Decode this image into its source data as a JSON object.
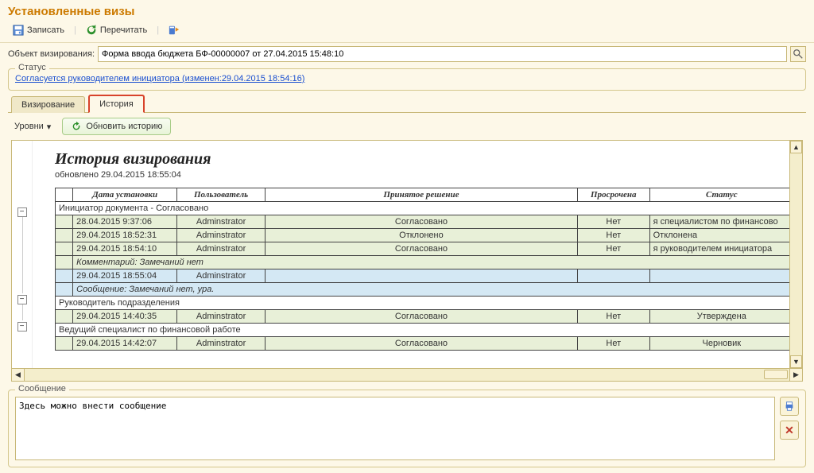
{
  "title": "Установленные визы",
  "toolbar": {
    "write": "Записать",
    "reread": "Перечитать"
  },
  "form": {
    "object_label": "Объект визирования:",
    "object_value": "Форма ввода бюджета БФ-00000007 от 27.04.2015 15:48:10"
  },
  "status_box": {
    "legend": "Статус",
    "text": "Согласуется руководителем инициатора (изменен:29.04.2015 18:54:16)"
  },
  "tabs": {
    "visirovanie": "Визирование",
    "istoriya": "История"
  },
  "subbar": {
    "levels": "Уровни",
    "refresh": "Обновить историю"
  },
  "history": {
    "title": "История визирования",
    "updated": "обновлено 29.04.2015 18:55:04",
    "headers": {
      "date": "Дата установки",
      "user": "Пользователь",
      "decision": "Принятое решение",
      "overdue": "Просрочена",
      "status": "Статус"
    },
    "section1": "Инициатор документа - Согласовано",
    "rows1": [
      {
        "date": "28.04.2015 9:37:06",
        "user": "Adminstrator",
        "decision": "Согласовано",
        "overdue": "Нет",
        "status": "я специалистом по финансово"
      },
      {
        "date": "29.04.2015 18:52:31",
        "user": "Adminstrator",
        "decision": "Отклонено",
        "overdue": "Нет",
        "status": "Отклонена"
      },
      {
        "date": "29.04.2015 18:54:10",
        "user": "Adminstrator",
        "decision": "Согласовано",
        "overdue": "Нет",
        "status": "я руководителем инициатора"
      }
    ],
    "comment1": "Комментарий: Замечаний нет",
    "row_blue": {
      "date": "29.04.2015 18:55:04",
      "user": "Adminstrator"
    },
    "message1": "Сообщение: Замечаний нет, ура.",
    "section2": "Руководитель подразделения",
    "rows2": [
      {
        "date": "29.04.2015 14:40:35",
        "user": "Adminstrator",
        "decision": "Согласовано",
        "overdue": "Нет",
        "status": "Утверждена"
      }
    ],
    "section3": "Ведущий специалист по финансовой работе",
    "rows3": [
      {
        "date": "29.04.2015 14:42:07",
        "user": "Adminstrator",
        "decision": "Согласовано",
        "overdue": "Нет",
        "status": "Черновик"
      }
    ]
  },
  "message_box": {
    "legend": "Сообщение",
    "value": "Здесь можно внести сообщение"
  }
}
